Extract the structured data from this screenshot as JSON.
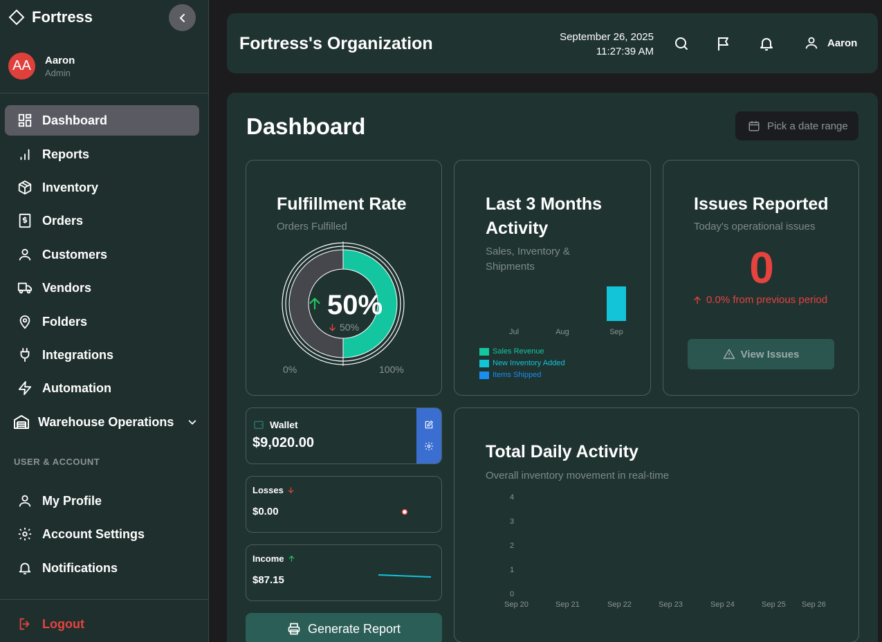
{
  "sidebar": {
    "brand": "Fortress",
    "user": {
      "initials": "AA",
      "name": "Aaron",
      "role": "Admin"
    },
    "items": [
      {
        "label": "Dashboard",
        "icon": "dashboard-icon"
      },
      {
        "label": "Reports",
        "icon": "bar-chart-icon"
      },
      {
        "label": "Inventory",
        "icon": "box-icon"
      },
      {
        "label": "Orders",
        "icon": "receipt-icon"
      },
      {
        "label": "Customers",
        "icon": "user-icon"
      },
      {
        "label": "Vendors",
        "icon": "truck-icon"
      },
      {
        "label": "Folders",
        "icon": "map-pin-icon"
      },
      {
        "label": "Integrations",
        "icon": "plug-icon"
      },
      {
        "label": "Automation",
        "icon": "lightning-icon"
      },
      {
        "label": "Warehouse Operations",
        "icon": "warehouse-icon"
      }
    ],
    "section_label": "USER & ACCOUNT",
    "account_items": [
      {
        "label": "My Profile",
        "icon": "user-icon"
      },
      {
        "label": "Account Settings",
        "icon": "gear-icon"
      },
      {
        "label": "Notifications",
        "icon": "bell-icon"
      }
    ],
    "logout": "Logout"
  },
  "header": {
    "org": "Fortress's Organization",
    "date": "September 26, 2025",
    "time": "11:27:39 AM",
    "user": "Aaron"
  },
  "main": {
    "title": "Dashboard",
    "date_range_placeholder": "Pick a date range"
  },
  "fulfillment": {
    "title": "Fulfillment Rate",
    "subtitle": "Orders Fulfilled",
    "value": "50%",
    "change": "50%",
    "min_label": "0%",
    "max_label": "100%",
    "rate": 0.5
  },
  "activity": {
    "title": "Last 3 Months Activity",
    "subtitle": "Sales, Inventory & Shipments",
    "chart_data": {
      "type": "bar",
      "categories": [
        "Jul",
        "Aug",
        "Sep"
      ],
      "series": [
        {
          "name": "Sales Revenue",
          "values": [
            0,
            0,
            0
          ]
        },
        {
          "name": "New Inventory Added",
          "values": [
            0,
            0,
            1
          ]
        },
        {
          "name": "Items Shipped",
          "values": [
            0,
            0,
            0
          ]
        }
      ],
      "ylim": [
        0,
        1
      ]
    },
    "colors": {
      "sales": "#14c6a0",
      "inventory": "#13c4d8",
      "shipped": "#1a8ef0"
    }
  },
  "issues": {
    "title": "Issues Reported",
    "subtitle": "Today's operational issues",
    "count": "0",
    "change": "0.0% from previous period",
    "button": "View Issues"
  },
  "wallet": {
    "label": "Wallet",
    "amount": "$9,020.00"
  },
  "losses": {
    "label": "Losses",
    "amount": "$0.00"
  },
  "income": {
    "label": "Income",
    "amount": "$87.15"
  },
  "generate_report": "Generate Report",
  "daily": {
    "title": "Total Daily Activity",
    "subtitle": "Overall inventory movement in real-time",
    "chart_data": {
      "type": "line",
      "x": [
        "Sep 20",
        "Sep 21",
        "Sep 22",
        "Sep 23",
        "Sep 24",
        "Sep 25",
        "Sep 26"
      ],
      "yticks": [
        "0",
        "1",
        "2",
        "3",
        "4"
      ],
      "ylim": [
        0,
        4
      ]
    }
  }
}
